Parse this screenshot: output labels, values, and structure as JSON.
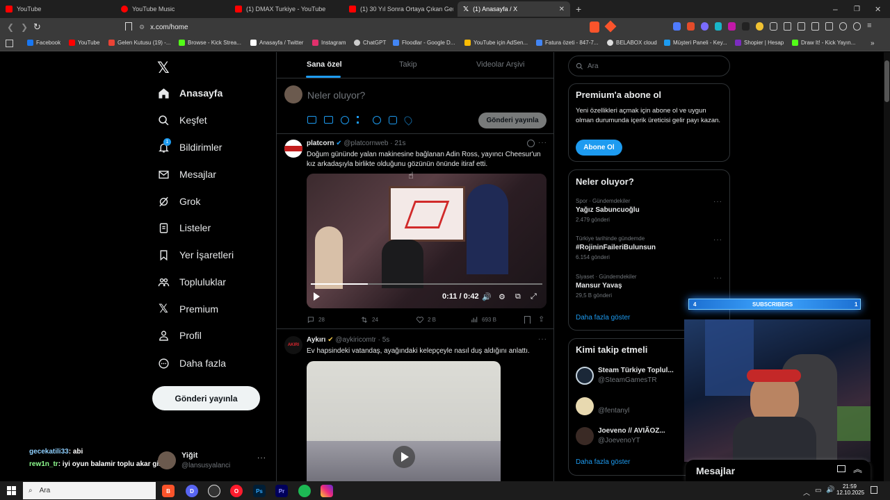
{
  "browser": {
    "tabs": [
      {
        "label": "YouTube",
        "color": "#ff0000"
      },
      {
        "label": "YouTube Music",
        "color": "#ff0000"
      },
      {
        "label": "(1) DMAX Turkiye - YouTube",
        "color": "#ff0000"
      },
      {
        "label": "(1) 30 Yıl Sonra Ortaya Çıkan Gerçek",
        "color": "#ff0000"
      },
      {
        "label": "(1) Anasayfa / X",
        "color": "#ffffff"
      }
    ],
    "url": "x.com/home",
    "bookmarks": [
      {
        "label": "Facebook",
        "color": "#1877f2"
      },
      {
        "label": "YouTube",
        "color": "#ff0000"
      },
      {
        "label": "Gelen Kutusu (19) -...",
        "color": "#ea4335"
      },
      {
        "label": "Browse - Kick Strea...",
        "color": "#53fc18"
      },
      {
        "label": "Anasayfa / Twitter",
        "color": "#ffffff"
      },
      {
        "label": "Instagram",
        "color": "#e1306c"
      },
      {
        "label": "ChatGPT",
        "color": "#cccccc"
      },
      {
        "label": "Floodlar - Google D...",
        "color": "#4285f4"
      },
      {
        "label": "YouTube için AdSen...",
        "color": "#fbbc04"
      },
      {
        "label": "Fatura özeti - 847-7...",
        "color": "#4285f4"
      },
      {
        "label": "BELABOX cloud",
        "color": "#dddddd"
      },
      {
        "label": "Müşteri Paneli - Key...",
        "color": "#1d9bf0"
      },
      {
        "label": "Shopier | Hesap",
        "color": "#7b2cbf"
      },
      {
        "label": "Draw It! - Kick Yayın...",
        "color": "#53fc18"
      }
    ]
  },
  "nav": {
    "items": [
      {
        "label": "Anasayfa",
        "icon": "home-icon"
      },
      {
        "label": "Keşfet",
        "icon": "search-icon"
      },
      {
        "label": "Bildirimler",
        "icon": "bell-icon",
        "badge": "1"
      },
      {
        "label": "Mesajlar",
        "icon": "mail-icon"
      },
      {
        "label": "Grok",
        "icon": "grok-icon"
      },
      {
        "label": "Listeler",
        "icon": "list-icon"
      },
      {
        "label": "Yer İşaretleri",
        "icon": "bookmark-icon"
      },
      {
        "label": "Topluluklar",
        "icon": "community-icon"
      },
      {
        "label": "Premium",
        "icon": "x-icon"
      },
      {
        "label": "Profil",
        "icon": "profile-icon"
      },
      {
        "label": "Daha fazla",
        "icon": "more-icon"
      }
    ],
    "post_button": "Gönderi yayınla",
    "account": {
      "name": "Yiğit",
      "handle": "@lansusyalanci"
    }
  },
  "chat_overlay": [
    {
      "user": "gecekatili33",
      "message": ": abi"
    },
    {
      "user": "rew1n_tr",
      "message": ": iyi oyun balamir toplu akar gibi"
    }
  ],
  "feed": {
    "tabs": [
      "Sana özel",
      "Takip",
      "Videolar Arşivi"
    ],
    "composer_placeholder": "Neler oluyor?",
    "composer_button": "Gönderi yayınla",
    "posts": [
      {
        "name": "platcorn",
        "handle": "@platcornweb · 21s",
        "text": "Doğum gününde yalan makinesine bağlanan Adin Ross, yayıncı Cheesur'un kız arkadaşıyla birlikte olduğunu gözünün önünde itiraf etti.",
        "video_time": "0:11 / 0:42",
        "replies": "28",
        "reposts": "24",
        "likes": "2 B",
        "views": "693 B"
      },
      {
        "name": "Aykırı",
        "handle": "@aykiricomtr · 5s",
        "text": "Ev hapsindeki vatandaş, ayağındaki kelepçeyle nasıl duş aldığını anlattı."
      }
    ]
  },
  "sidebar": {
    "search_placeholder": "Ara",
    "premium": {
      "title": "Premium'a abone ol",
      "text": "Yeni özellikleri açmak için abone ol ve uygun olman durumunda içerik üreticisi gelir payı kazan.",
      "button": "Abone Ol"
    },
    "trends_title": "Neler oluyor?",
    "trends": [
      {
        "context": "Spor · Gündemdekiler",
        "topic": "Yağız Sabuncuoğlu",
        "count": "2.479 gönderi"
      },
      {
        "context": "Türkiye tarihinde gündemde",
        "topic": "#RojininFaileriBulunsun",
        "count": "6.154 gönderi"
      },
      {
        "context": "Siyaset · Gündemdekiler",
        "topic": "Mansur Yavaş",
        "count": "29,5 B gönderi"
      }
    ],
    "show_more": "Daha fazla göster",
    "follow_title": "Kimi takip etmeli",
    "follow": [
      {
        "name": "Steam Türkiye Toplul...",
        "handle": "@SteamGamesTR"
      },
      {
        "name": "",
        "handle": "@fentanyl"
      },
      {
        "name": "Joeveno // AVIÃOZ...",
        "handle": "@JoevenoYT"
      }
    ],
    "follow_more": "Daha fazla göster"
  },
  "messages_drawer": "Mesajlar",
  "subscribers_bar": {
    "label": "SUBSCRIBERS",
    "left": "4",
    "right": "1"
  },
  "taskbar": {
    "search": "Ara",
    "time": "21:59",
    "date": "12.10.2025"
  }
}
